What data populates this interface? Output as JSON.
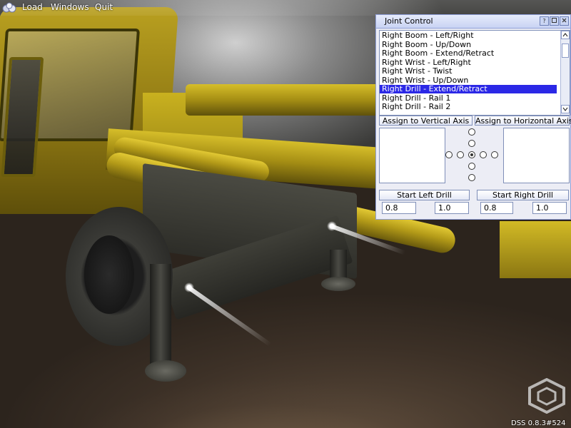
{
  "menu": {
    "items": [
      {
        "label": "Load"
      },
      {
        "label": "Windows"
      },
      {
        "label": "Quit"
      }
    ]
  },
  "joint_control": {
    "title": "Joint Control",
    "joints": [
      {
        "label": "Right Boom - Left/Right",
        "selected": false
      },
      {
        "label": "Right Boom - Up/Down",
        "selected": false
      },
      {
        "label": "Right Boom - Extend/Retract",
        "selected": false
      },
      {
        "label": "Right Wrist - Left/Right",
        "selected": false
      },
      {
        "label": "Right Wrist - Twist",
        "selected": false
      },
      {
        "label": "Right Wrist - Up/Down",
        "selected": false
      },
      {
        "label": "Right Drill - Extend/Retract",
        "selected": true
      },
      {
        "label": "Right Drill - Rail 1",
        "selected": false
      },
      {
        "label": "Right Drill - Rail 2",
        "selected": false
      }
    ],
    "assign_vertical_label": "Assign to Vertical Axis",
    "assign_horizontal_label": "Assign to Horizontal Axis",
    "start_left_drill_label": "Start Left Drill",
    "start_right_drill_label": "Start Right Drill",
    "left_value_1": "0.8",
    "left_value_2": "1.0",
    "right_value_1": "0.8",
    "right_value_2": "1.0"
  },
  "version": "DSS 0.8.3#524",
  "icons": {
    "app_logo": "app-logo-icon",
    "help": "help-icon",
    "minimize": "minimize-icon",
    "close": "close-icon",
    "scroll_up": "scroll-up-icon",
    "scroll_down": "scroll-down-icon",
    "watermark": "hexagon-logo-icon"
  },
  "colors": {
    "selection": "#2b28e6",
    "window_border": "#8f9fd8",
    "window_bg": "#ecedf5"
  }
}
